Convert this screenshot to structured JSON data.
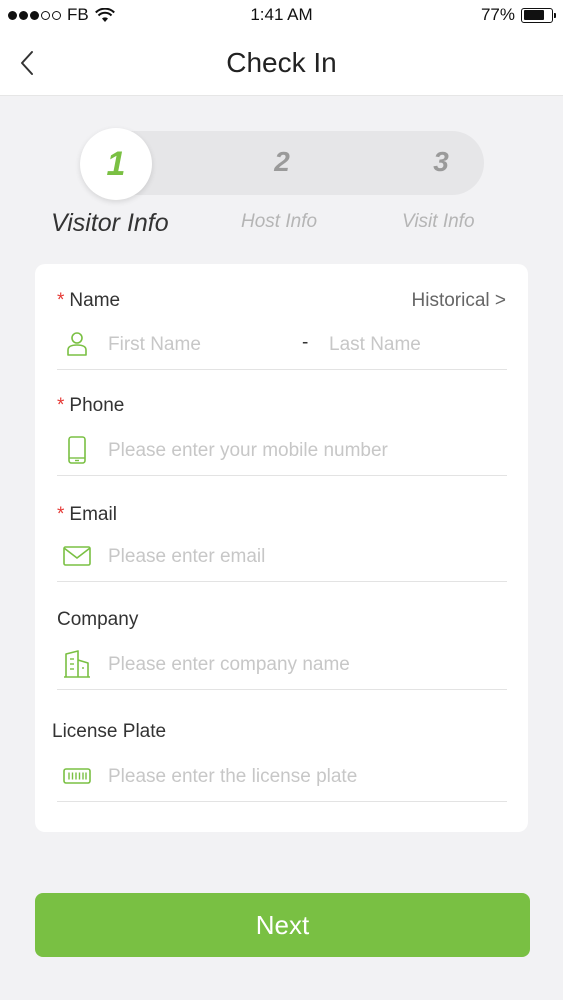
{
  "status_bar": {
    "carrier": "FB",
    "time": "1:41 AM",
    "battery_percent": "77%",
    "battery_level": 0.77
  },
  "nav": {
    "title": "Check In",
    "back_icon": "chevron-left-icon"
  },
  "stepper": {
    "steps": [
      {
        "number": "1",
        "label": "Visitor Info",
        "active": true
      },
      {
        "number": "2",
        "label": "Host Info",
        "active": false
      },
      {
        "number": "3",
        "label": "Visit Info",
        "active": false
      }
    ],
    "active_color": "#7ac043"
  },
  "form": {
    "required_mark": "*",
    "name": {
      "label": "Name",
      "historical_link": "Historical >",
      "first_placeholder": "First Name",
      "separator": "-",
      "last_placeholder": "Last Name",
      "icon": "person-icon"
    },
    "phone": {
      "label": "Phone",
      "placeholder": "Please enter your mobile number",
      "icon": "mobile-phone-icon"
    },
    "email": {
      "label": "Email",
      "placeholder": "Please enter email",
      "icon": "envelope-icon"
    },
    "company": {
      "label": "Company",
      "placeholder": "Please enter company name",
      "icon": "building-icon"
    },
    "license_plate": {
      "label": "License Plate",
      "placeholder": "Please enter the license plate",
      "icon": "license-plate-icon"
    }
  },
  "next_button": {
    "label": "Next",
    "color": "#79c043"
  },
  "colors": {
    "accent": "#79c043",
    "required": "#e53935",
    "background": "#f2f2f4"
  }
}
